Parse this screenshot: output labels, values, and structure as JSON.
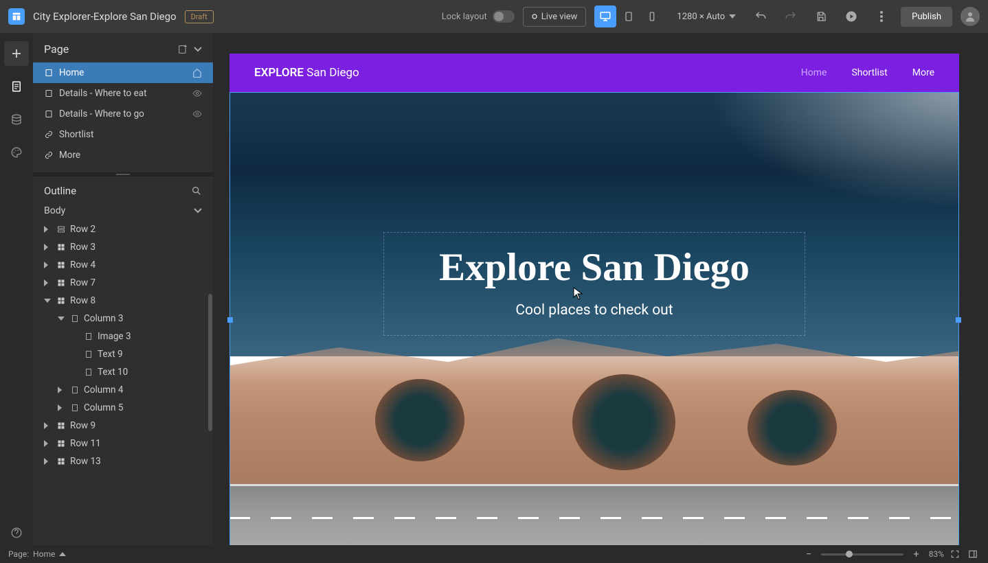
{
  "topbar": {
    "project_title": "City Explorer-Explore San Diego",
    "draft_label": "Draft",
    "lock_layout_label": "Lock layout",
    "live_view_label": "Live view",
    "viewport_size": "1280 × Auto",
    "publish_label": "Publish"
  },
  "pages": {
    "section_title": "Page",
    "items": [
      {
        "label": "Home",
        "icon": "page",
        "selected": true,
        "trailing": "home"
      },
      {
        "label": "Details - Where to eat",
        "icon": "page",
        "trailing": "hidden"
      },
      {
        "label": "Details - Where to go",
        "icon": "page",
        "trailing": "hidden"
      },
      {
        "label": "Shortlist",
        "icon": "link"
      },
      {
        "label": "More",
        "icon": "link"
      }
    ]
  },
  "outline": {
    "section_title": "Outline",
    "body_label": "Body",
    "items": [
      {
        "label": "Row 2",
        "depth": 0,
        "expanded": false,
        "icon": "row"
      },
      {
        "label": "Row 3",
        "depth": 0,
        "expanded": false,
        "icon": "grid"
      },
      {
        "label": "Row 4",
        "depth": 0,
        "expanded": false,
        "icon": "grid"
      },
      {
        "label": "Row 7",
        "depth": 0,
        "expanded": false,
        "icon": "grid"
      },
      {
        "label": "Row 8",
        "depth": 0,
        "expanded": true,
        "icon": "grid"
      },
      {
        "label": "Column 3",
        "depth": 1,
        "expanded": true,
        "icon": "col"
      },
      {
        "label": "Image 3",
        "depth": 2,
        "icon": "col"
      },
      {
        "label": "Text 9",
        "depth": 2,
        "icon": "col"
      },
      {
        "label": "Text 10",
        "depth": 2,
        "icon": "col"
      },
      {
        "label": "Column 4",
        "depth": 1,
        "expanded": false,
        "icon": "col"
      },
      {
        "label": "Column 5",
        "depth": 1,
        "expanded": false,
        "icon": "col"
      },
      {
        "label": "Row 9",
        "depth": 0,
        "expanded": false,
        "icon": "grid"
      },
      {
        "label": "Row 11",
        "depth": 0,
        "expanded": false,
        "icon": "grid"
      },
      {
        "label": "Row 13",
        "depth": 0,
        "expanded": false,
        "icon": "grid"
      }
    ]
  },
  "site": {
    "brand_bold": "EXPLORE",
    "brand_light": " San Diego",
    "nav_links": [
      {
        "label": "Home",
        "active": true
      },
      {
        "label": "Shortlist"
      },
      {
        "label": "More"
      }
    ],
    "hero_title": "Explore San Diego",
    "hero_subtitle": "Cool places to check out"
  },
  "bottombar": {
    "page_prefix": "Page:",
    "page_name": "Home",
    "zoom_pct": "83%"
  }
}
